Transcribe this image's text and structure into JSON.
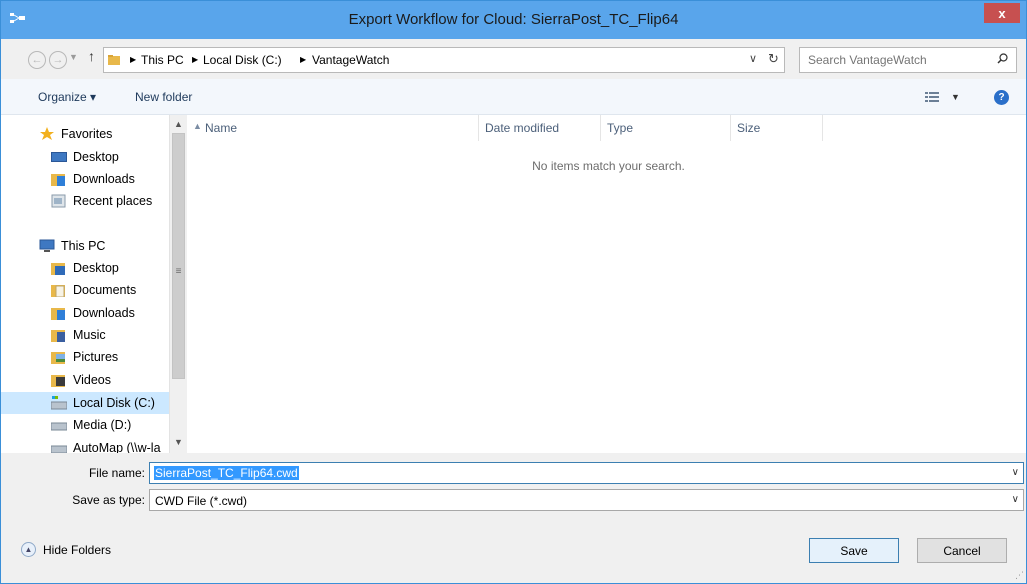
{
  "window": {
    "title": "Export Workflow for Cloud: SierraPost_TC_Flip64",
    "close_label": "x"
  },
  "address": {
    "breadcrumbs": [
      "This PC",
      "Local Disk (C:)",
      "VantageWatch"
    ]
  },
  "search": {
    "placeholder": "Search VantageWatch"
  },
  "toolbar": {
    "organize_label": "Organize ▾",
    "new_folder_label": "New folder"
  },
  "sidebar": {
    "favorites": {
      "label": "Favorites",
      "items": [
        {
          "label": "Desktop",
          "icon": "desktop-icon"
        },
        {
          "label": "Downloads",
          "icon": "downloads-icon"
        },
        {
          "label": "Recent places",
          "icon": "recent-places-icon"
        }
      ]
    },
    "this_pc": {
      "label": "This PC",
      "items": [
        {
          "label": "Desktop",
          "icon": "desktop-icon"
        },
        {
          "label": "Documents",
          "icon": "documents-icon"
        },
        {
          "label": "Downloads",
          "icon": "downloads-icon"
        },
        {
          "label": "Music",
          "icon": "music-icon"
        },
        {
          "label": "Pictures",
          "icon": "pictures-icon"
        },
        {
          "label": "Videos",
          "icon": "videos-icon"
        },
        {
          "label": "Local Disk (C:)",
          "icon": "drive-icon",
          "selected": true
        },
        {
          "label": "Media (D:)",
          "icon": "drive-icon"
        },
        {
          "label": "AutoMap (\\\\w-la",
          "icon": "network-drive-icon"
        }
      ]
    }
  },
  "file_list": {
    "columns": [
      "Name",
      "Date modified",
      "Type",
      "Size"
    ],
    "empty_message": "No items match your search."
  },
  "form": {
    "file_name_label": "File name:",
    "file_name_value": "SierraPost_TC_Flip64.cwd",
    "save_type_label": "Save as type:",
    "save_type_value": "CWD File (*.cwd)"
  },
  "footer": {
    "hide_folders_label": "Hide Folders",
    "save_label": "Save",
    "cancel_label": "Cancel"
  },
  "colors": {
    "titlebar": "#59a5eb",
    "close": "#c75050",
    "selection": "#cce8ff",
    "text_selection": "#3399ff"
  }
}
